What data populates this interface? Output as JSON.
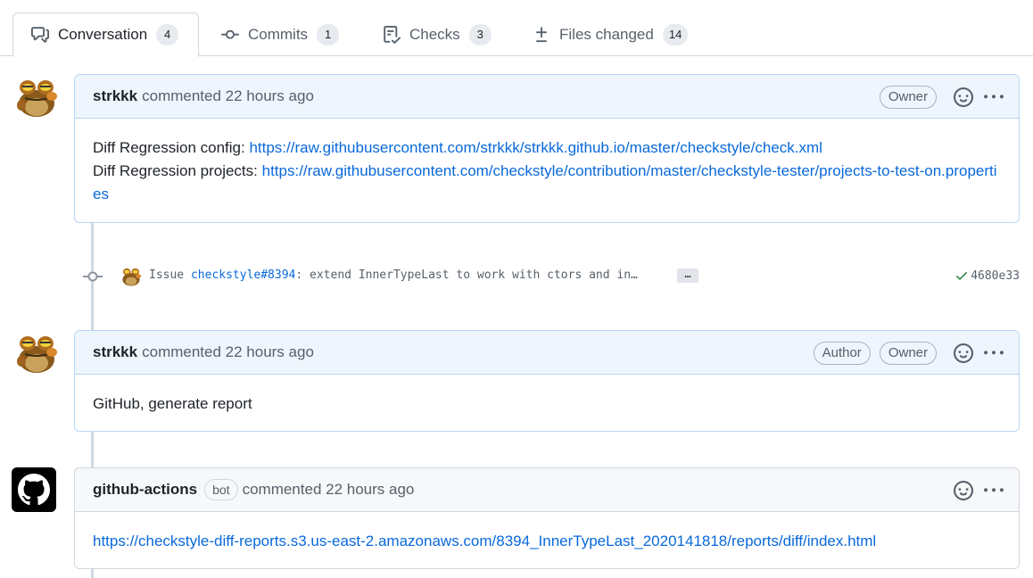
{
  "tabs": [
    {
      "label": "Conversation",
      "count": "4",
      "icon": "comment-discussion-icon"
    },
    {
      "label": "Commits",
      "count": "1",
      "icon": "git-commit-icon"
    },
    {
      "label": "Checks",
      "count": "3",
      "icon": "checklist-icon"
    },
    {
      "label": "Files changed",
      "count": "14",
      "icon": "file-diff-icon"
    }
  ],
  "comments": [
    {
      "author": "strkkk",
      "meta": "commented 22 hours ago",
      "badges": [
        "Owner"
      ],
      "body": {
        "line1_prefix": "Diff Regression config: ",
        "line1_link": "https://raw.githubusercontent.com/strkkk/strkkk.github.io/master/checkstyle/check.xml",
        "line2_prefix": "Diff Regression projects: ",
        "line2_link": "https://raw.githubusercontent.com/checkstyle/contribution/master/checkstyle-tester/projects-to-test-on.properties"
      }
    },
    {
      "author": "strkkk",
      "meta": "commented 22 hours ago",
      "badges": [
        "Author",
        "Owner"
      ],
      "body": {
        "text": "GitHub, generate report"
      }
    },
    {
      "author": "github-actions",
      "bot_label": "bot",
      "meta": "commented 22 hours ago",
      "body": {
        "link": "https://checkstyle-diff-reports.s3.us-east-2.amazonaws.com/8394_InnerTypeLast_2020141818/reports/diff/index.html"
      }
    }
  ],
  "commit": {
    "prefix": "Issue ",
    "issue_link": "checkstyle#8394",
    "rest": ": extend InnerTypeLast to work with ctors and in…",
    "ellipsis": "…",
    "sha": "4680e33",
    "status": "success"
  },
  "colors": {
    "link": "#0969da",
    "header_bg": "#eef5fd",
    "success": "#1a7f37"
  }
}
